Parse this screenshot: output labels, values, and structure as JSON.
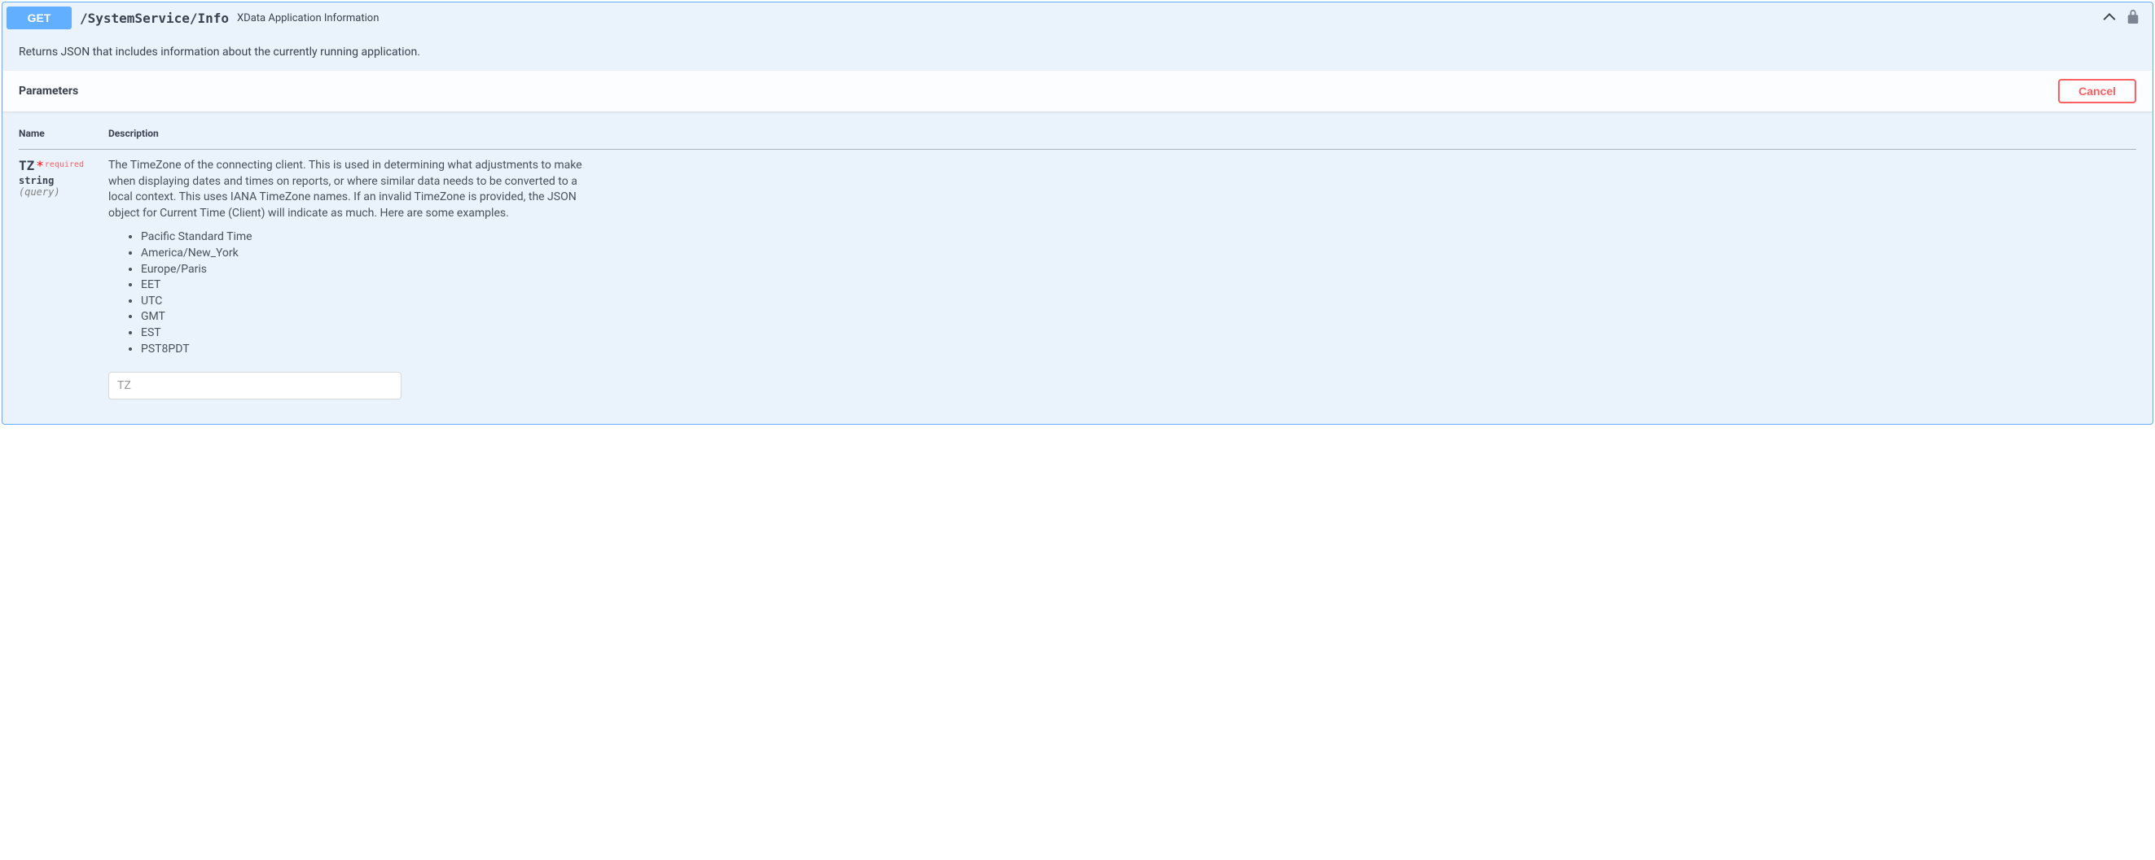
{
  "operation": {
    "method": "GET",
    "path": "/SystemService/Info",
    "summary": "XData Application Information",
    "description": "Returns JSON that includes information about the currently running application."
  },
  "sections": {
    "parameters_title": "Parameters",
    "cancel_button": "Cancel"
  },
  "table": {
    "col_name": "Name",
    "col_description": "Description"
  },
  "parameters": [
    {
      "name": "TZ",
      "required_star": "*",
      "required_label": "required",
      "type": "string",
      "in": "(query)",
      "description": "The TimeZone of the connecting client. This is used in determining what adjustments to make when displaying dates and times on reports, or where similar data needs to be converted to a local context. This uses IANA TimeZone names. If an invalid TimeZone is provided, the JSON object for Current Time (Client) will indicate as much. Here are some examples.",
      "examples": [
        "Pacific Standard Time",
        "America/New_York",
        "Europe/Paris",
        "EET",
        "UTC",
        "GMT",
        "EST",
        "PST8PDT"
      ],
      "placeholder": "TZ",
      "value": ""
    }
  ]
}
